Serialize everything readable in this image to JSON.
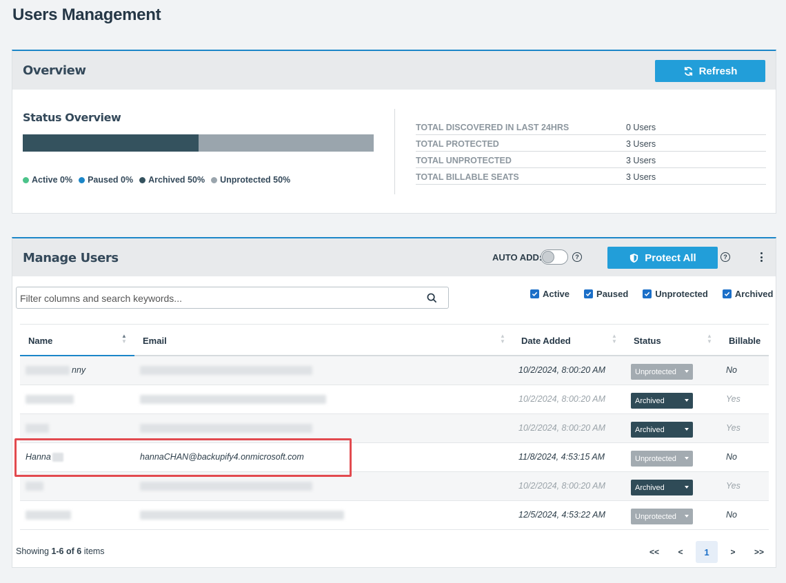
{
  "page": {
    "title": "Users Management"
  },
  "overview": {
    "title": "Overview",
    "refresh_label": "Refresh",
    "status_title": "Status Overview",
    "bar": {
      "archived_fraction": 0.5,
      "unprotected_fraction": 0.5,
      "archived_color": "#34525e",
      "unprotected_color": "#9aa5ad"
    },
    "legend": [
      {
        "label": "Active 0%",
        "color": "#4cc38a"
      },
      {
        "label": "Paused 0%",
        "color": "#1b86c8"
      },
      {
        "label": "Archived 50%",
        "color": "#34525e"
      },
      {
        "label": "Unprotected 50%",
        "color": "#9aa5ad"
      }
    ],
    "stats": [
      {
        "label": "TOTAL DISCOVERED IN LAST 24HRS",
        "value": "0 Users"
      },
      {
        "label": "TOTAL PROTECTED",
        "value": "3 Users"
      },
      {
        "label": "TOTAL UNPROTECTED",
        "value": "3 Users"
      },
      {
        "label": "TOTAL BILLABLE SEATS",
        "value": "3 Users"
      }
    ]
  },
  "manage": {
    "title": "Manage Users",
    "auto_add_label": "AUTO ADD:",
    "auto_add_on": false,
    "protect_all_label": "Protect All",
    "help_glyph": "?",
    "search_placeholder": "Filter columns and search keywords...",
    "filters": [
      {
        "label": "Active",
        "checked": true
      },
      {
        "label": "Paused",
        "checked": true
      },
      {
        "label": "Unprotected",
        "checked": true
      },
      {
        "label": "Archived",
        "checked": true
      }
    ],
    "columns": [
      "Name",
      "Email",
      "Date Added",
      "Status",
      "Billable"
    ],
    "rows": [
      {
        "name": "nny",
        "email": "",
        "date": "10/2/2024, 8:00:20 AM",
        "status": "Unprotected",
        "billable": "No"
      },
      {
        "name": "",
        "email": "",
        "date": "10/2/2024, 8:00:20 AM",
        "status": "Archived",
        "billable": "Yes"
      },
      {
        "name": "",
        "email": "",
        "date": "10/2/2024, 8:00:20 AM",
        "status": "Archived",
        "billable": "Yes"
      },
      {
        "name": "Hanna",
        "email": "hannaCHAN@backupify4.onmicrosoft.com",
        "date": "11/8/2024, 4:53:15 AM",
        "status": "Unprotected",
        "billable": "No"
      },
      {
        "name": "",
        "email": "",
        "date": "10/2/2024, 8:00:20 AM",
        "status": "Archived",
        "billable": "Yes"
      },
      {
        "name": "",
        "email": "",
        "date": "12/5/2024, 4:53:22 AM",
        "status": "Unprotected",
        "billable": "No"
      }
    ],
    "showing": {
      "prefix": "Showing ",
      "range": "1-6",
      "of": " of ",
      "total": "6",
      "suffix": " items"
    },
    "pager": {
      "first": "<<",
      "prev": "<",
      "current": "1",
      "next": ">",
      "last": ">>"
    }
  }
}
